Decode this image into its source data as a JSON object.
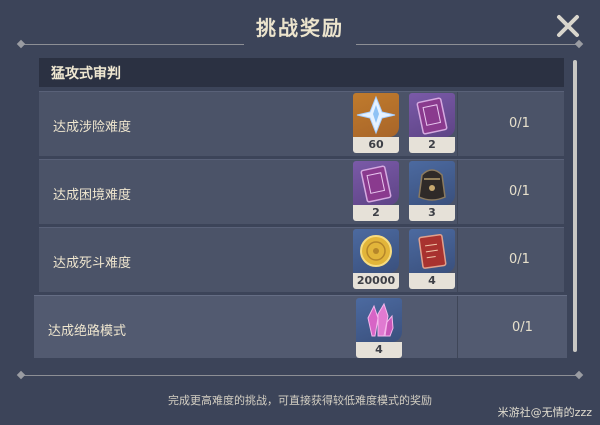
{
  "header": {
    "title": "挑战奖励",
    "close_icon": "close-icon"
  },
  "section": {
    "title": "猛攻式审判"
  },
  "rows": [
    {
      "label": "达成涉险难度",
      "progress": "0/1",
      "rewards": [
        {
          "icon": "primogem-icon",
          "count": "60",
          "color": "#c07b2c"
        },
        {
          "icon": "purple-book-icon",
          "count": "2",
          "color": "#7a5aa8"
        }
      ]
    },
    {
      "label": "达成困境难度",
      "progress": "0/1",
      "rewards": [
        {
          "icon": "purple-book-icon",
          "count": "2",
          "color": "#7a5aa8"
        },
        {
          "icon": "dark-pouch-icon",
          "count": "3",
          "color": "#4c6aa0"
        }
      ]
    },
    {
      "label": "达成死斗难度",
      "progress": "0/1",
      "rewards": [
        {
          "icon": "mora-coin-icon",
          "count": "20000",
          "color": "#4c6aa0"
        },
        {
          "icon": "red-book-icon",
          "count": "4",
          "color": "#4c6aa0"
        }
      ]
    },
    {
      "label": "达成绝路模式",
      "progress": "0/1",
      "rewards": [
        {
          "icon": "pink-crystal-icon",
          "count": "4",
          "color": "#4c6aa0"
        }
      ]
    }
  ],
  "footer": {
    "note": "完成更高难度的挑战，可直接获得较低难度模式的奖励"
  },
  "watermark": "米游社@无情的zzz"
}
